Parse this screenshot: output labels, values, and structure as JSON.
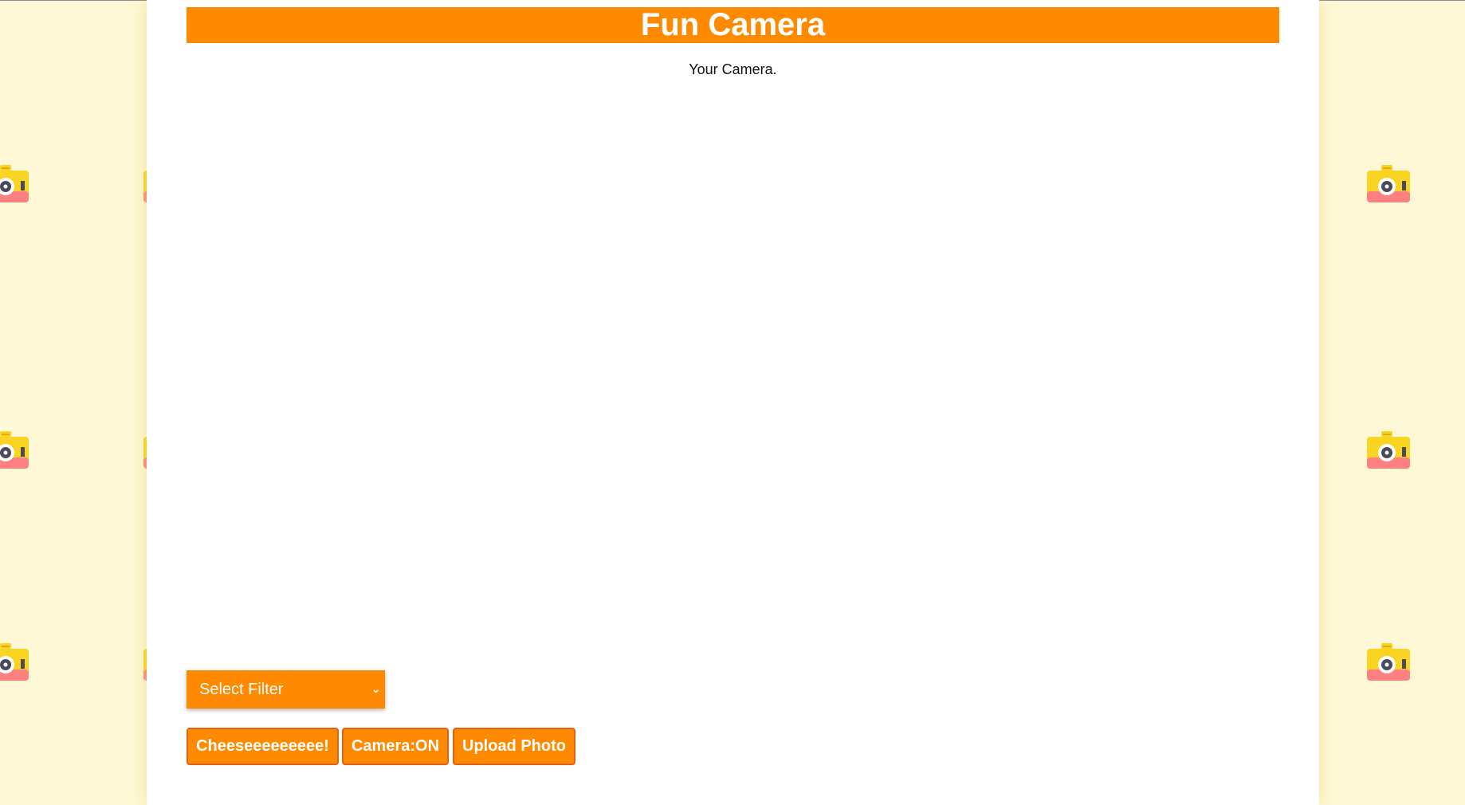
{
  "app": {
    "title": "Fun Camera",
    "subtitle": "Your Camera."
  },
  "controls": {
    "filter_select": {
      "selected": "Select Filter"
    },
    "buttons": {
      "capture_label": "Cheeseeeeeeeee!",
      "camera_toggle_label": "Camera:ON",
      "upload_label": "Upload Photo"
    }
  },
  "background": {
    "icon": "camera-icon",
    "colors": {
      "page": "#fff8d6",
      "accent": "#ff8a00",
      "camera_body": "#f9d423",
      "camera_base": "#ff8080",
      "lens": "#4a4a5a"
    }
  }
}
